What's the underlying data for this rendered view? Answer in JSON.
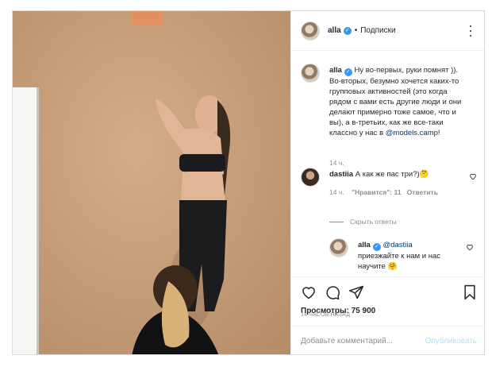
{
  "post": {
    "username": "alla",
    "separator": "•",
    "follow_label": "Подписки"
  },
  "caption": {
    "username": "alla",
    "text": "Ну во-первых, руки помнят )). Во-вторых, безумно хочется каких-то групповых активностей (это когда рядом с вами есть другие люди и они делают примерно тоже самое, что и вы), а в-третьих, как же все-таки классно у нас в ",
    "mention": "@models.camp",
    "text_end": "!",
    "time": "14 ч."
  },
  "comment": {
    "username": "dastiia",
    "text": "А как же пас три?)🤔",
    "time": "14 ч.",
    "likes": "\"Нравится\": 11",
    "reply_label": "Ответить"
  },
  "hide_replies": "Скрыть ответы",
  "reply": {
    "username": "alla",
    "mention": "@dastiia",
    "text": "приезжайте к нам и нас научите 🤗"
  },
  "stats": {
    "views": "Просмотры: 75 900",
    "posted_ago": "14 ЧАСОВ НАЗАД"
  },
  "compose": {
    "placeholder": "Добавьте комментарий...",
    "publish_label": "Опубликовать"
  },
  "icons": {
    "more": "more-options-icon",
    "like": "heart-icon",
    "comment": "comment-icon",
    "share": "share-icon",
    "save": "bookmark-icon",
    "verified": "verified-badge-icon"
  },
  "colors": {
    "verified": "#3897f0",
    "link": "#00376b",
    "muted": "#8e8e8e",
    "publish_disabled": "#b2dffc"
  }
}
